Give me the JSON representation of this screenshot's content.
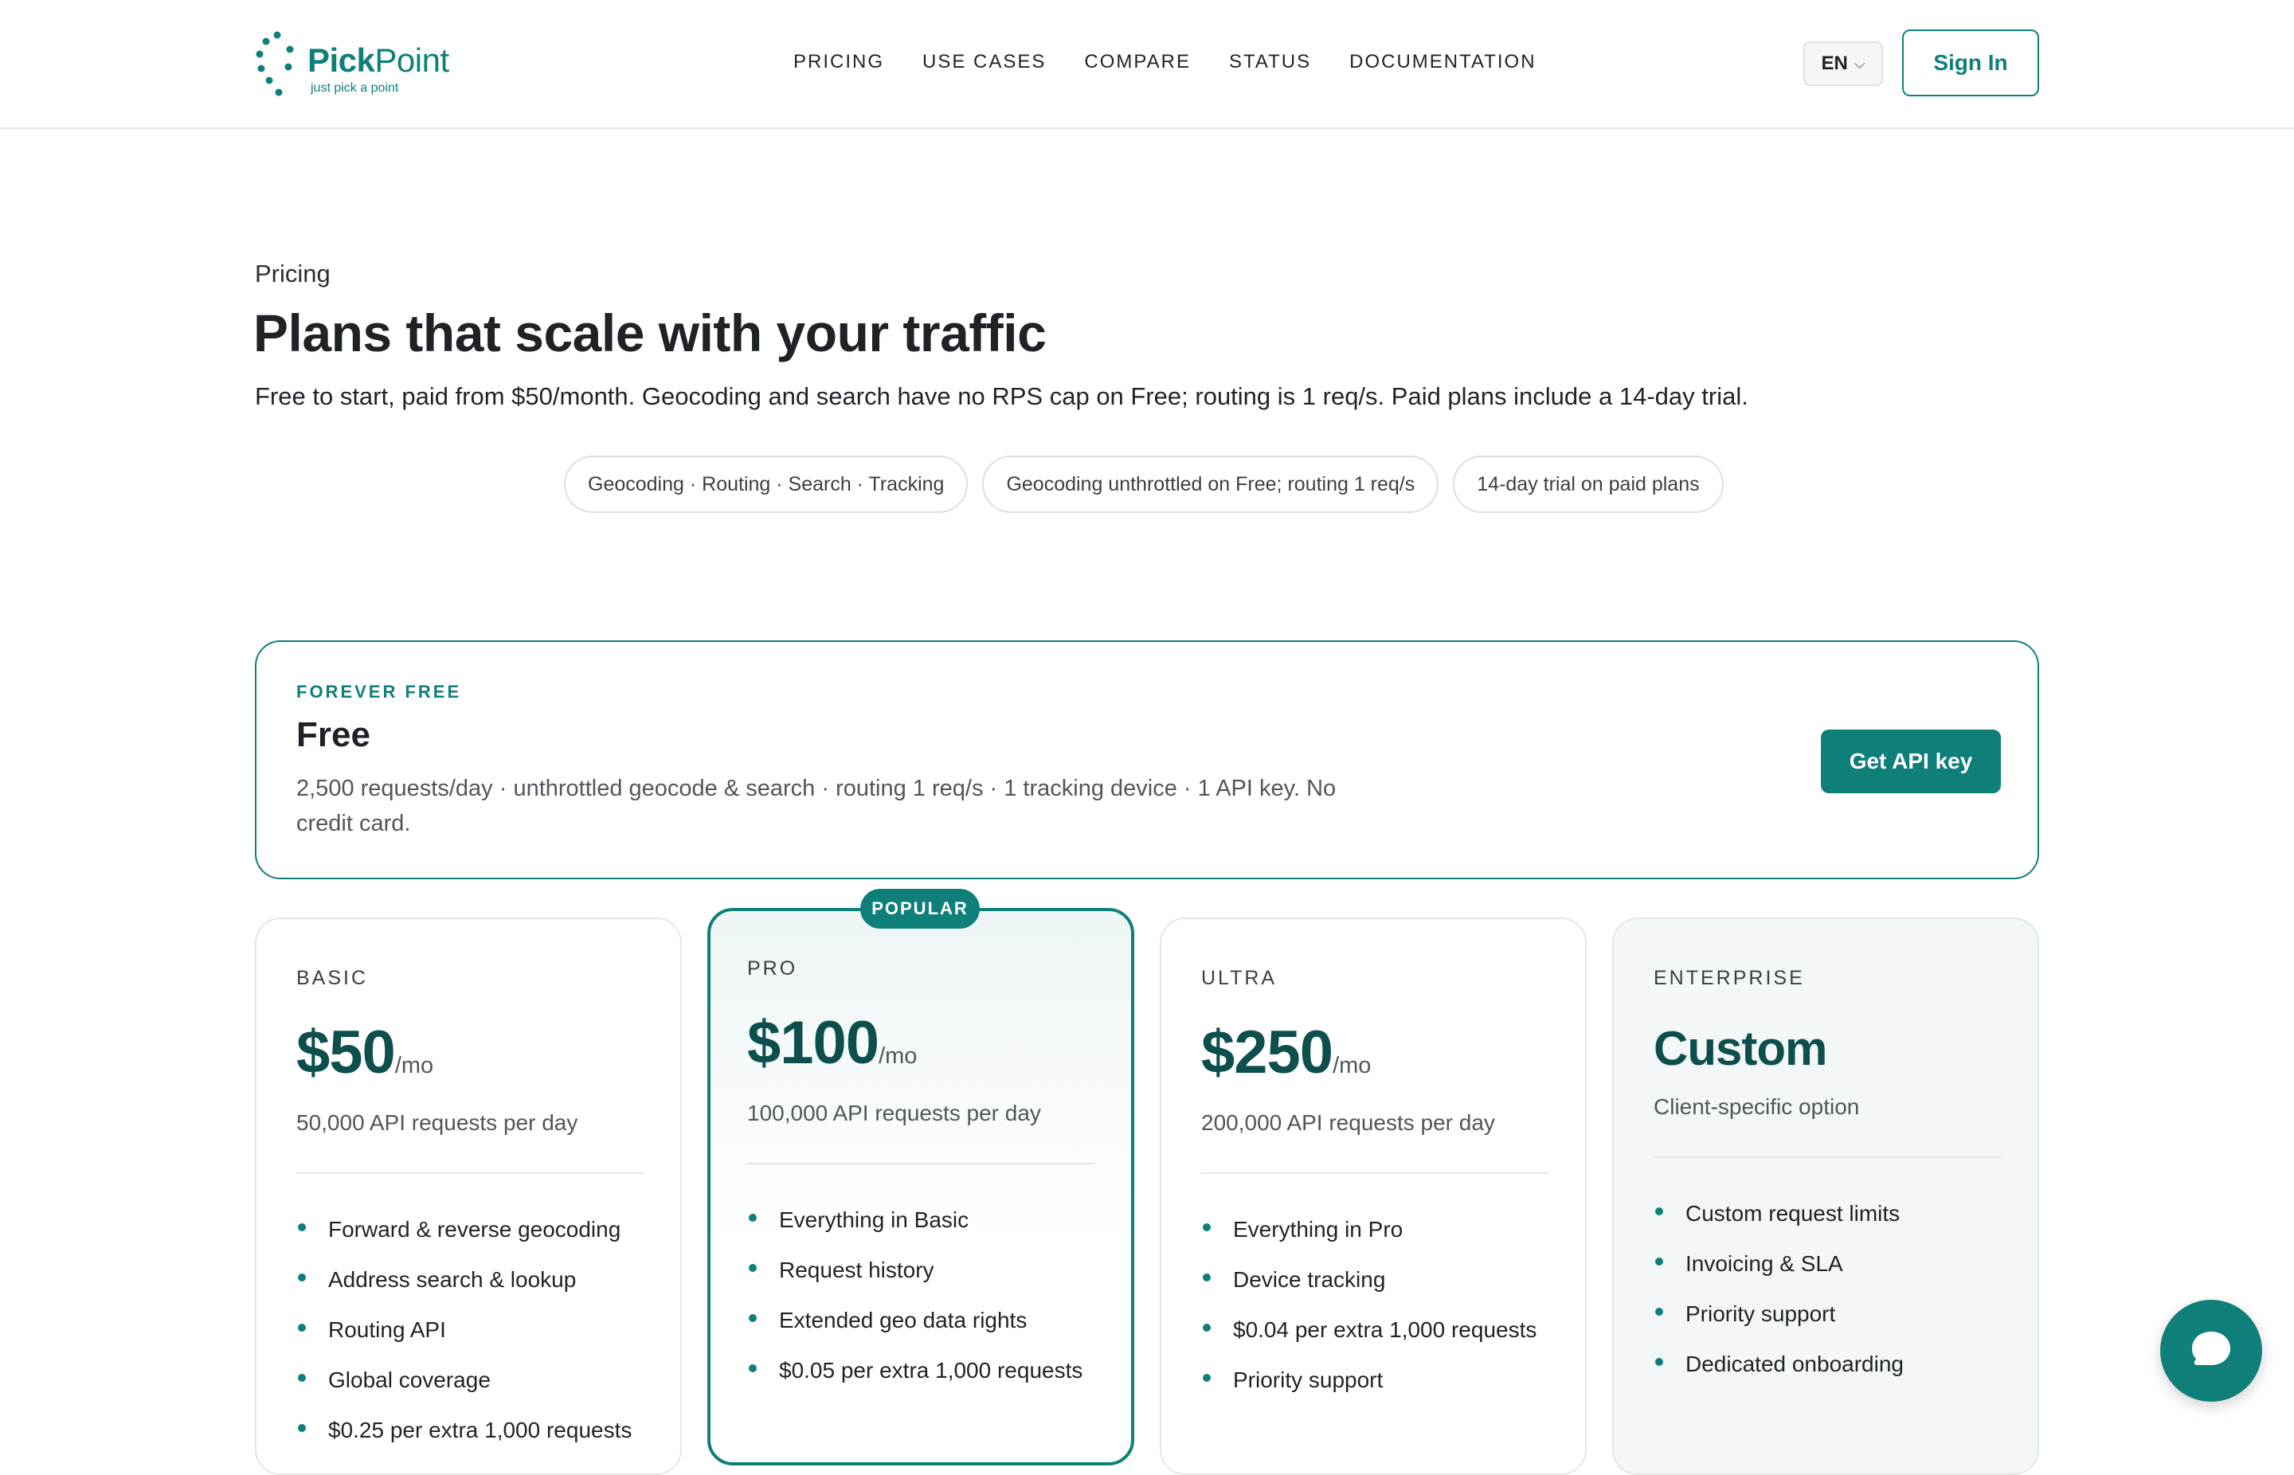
{
  "brand": {
    "name_bold": "Pick",
    "name_thin": "Point",
    "tagline": "just pick a point",
    "accent_color": "#0f7f7a",
    "dark_accent_color": "#0d4f4c"
  },
  "nav": {
    "items": [
      "PRICING",
      "USE CASES",
      "COMPARE",
      "STATUS",
      "DOCUMENTATION"
    ]
  },
  "header": {
    "language": "EN",
    "sign_in": "Sign In"
  },
  "hero": {
    "eyebrow": "Pricing",
    "title": "Plans that scale with your traffic",
    "subtitle": "Free to start, paid from $50/month. Geocoding and search have no RPS cap on Free; routing is 1 req/s. Paid plans include a 14-day trial.",
    "chips": [
      "Geocoding · Routing · Search · Tracking",
      "Geocoding unthrottled on Free; routing 1 req/s",
      "14-day trial on paid plans"
    ]
  },
  "free_plan": {
    "eyebrow": "FOREVER FREE",
    "title": "Free",
    "description": "2,500 requests/day · unthrottled geocode & search · routing 1 req/s · 1 tracking device · 1 API key. No credit card.",
    "cta": "Get API key"
  },
  "plans": {
    "basic": {
      "label": "BASIC",
      "price": "$50",
      "period": "/mo",
      "requests": "50,000 API requests per day",
      "features": [
        "Forward & reverse geocoding",
        "Address search & lookup",
        "Routing API",
        "Global coverage",
        "$0.25 per extra 1,000 requests"
      ]
    },
    "pro": {
      "badge": "POPULAR",
      "label": "PRO",
      "price": "$100",
      "period": "/mo",
      "requests": "100,000 API requests per day",
      "features": [
        "Everything in Basic",
        "Request history",
        "Extended geo data rights",
        "$0.05 per extra 1,000 requests"
      ]
    },
    "ultra": {
      "label": "ULTRA",
      "price": "$250",
      "period": "/mo",
      "requests": "200,000 API requests per day",
      "features": [
        "Everything in Pro",
        "Device tracking",
        "$0.04 per extra 1,000 requests",
        "Priority support"
      ]
    },
    "enterprise": {
      "label": "ENTERPRISE",
      "price": "Custom",
      "requests": "Client-specific option",
      "features": [
        "Custom request limits",
        "Invoicing & SLA",
        "Priority support",
        "Dedicated onboarding"
      ]
    }
  },
  "icons": {
    "chevron": "chevron-down-icon",
    "chat": "chat-icon",
    "logo": "logo-dots-icon"
  }
}
